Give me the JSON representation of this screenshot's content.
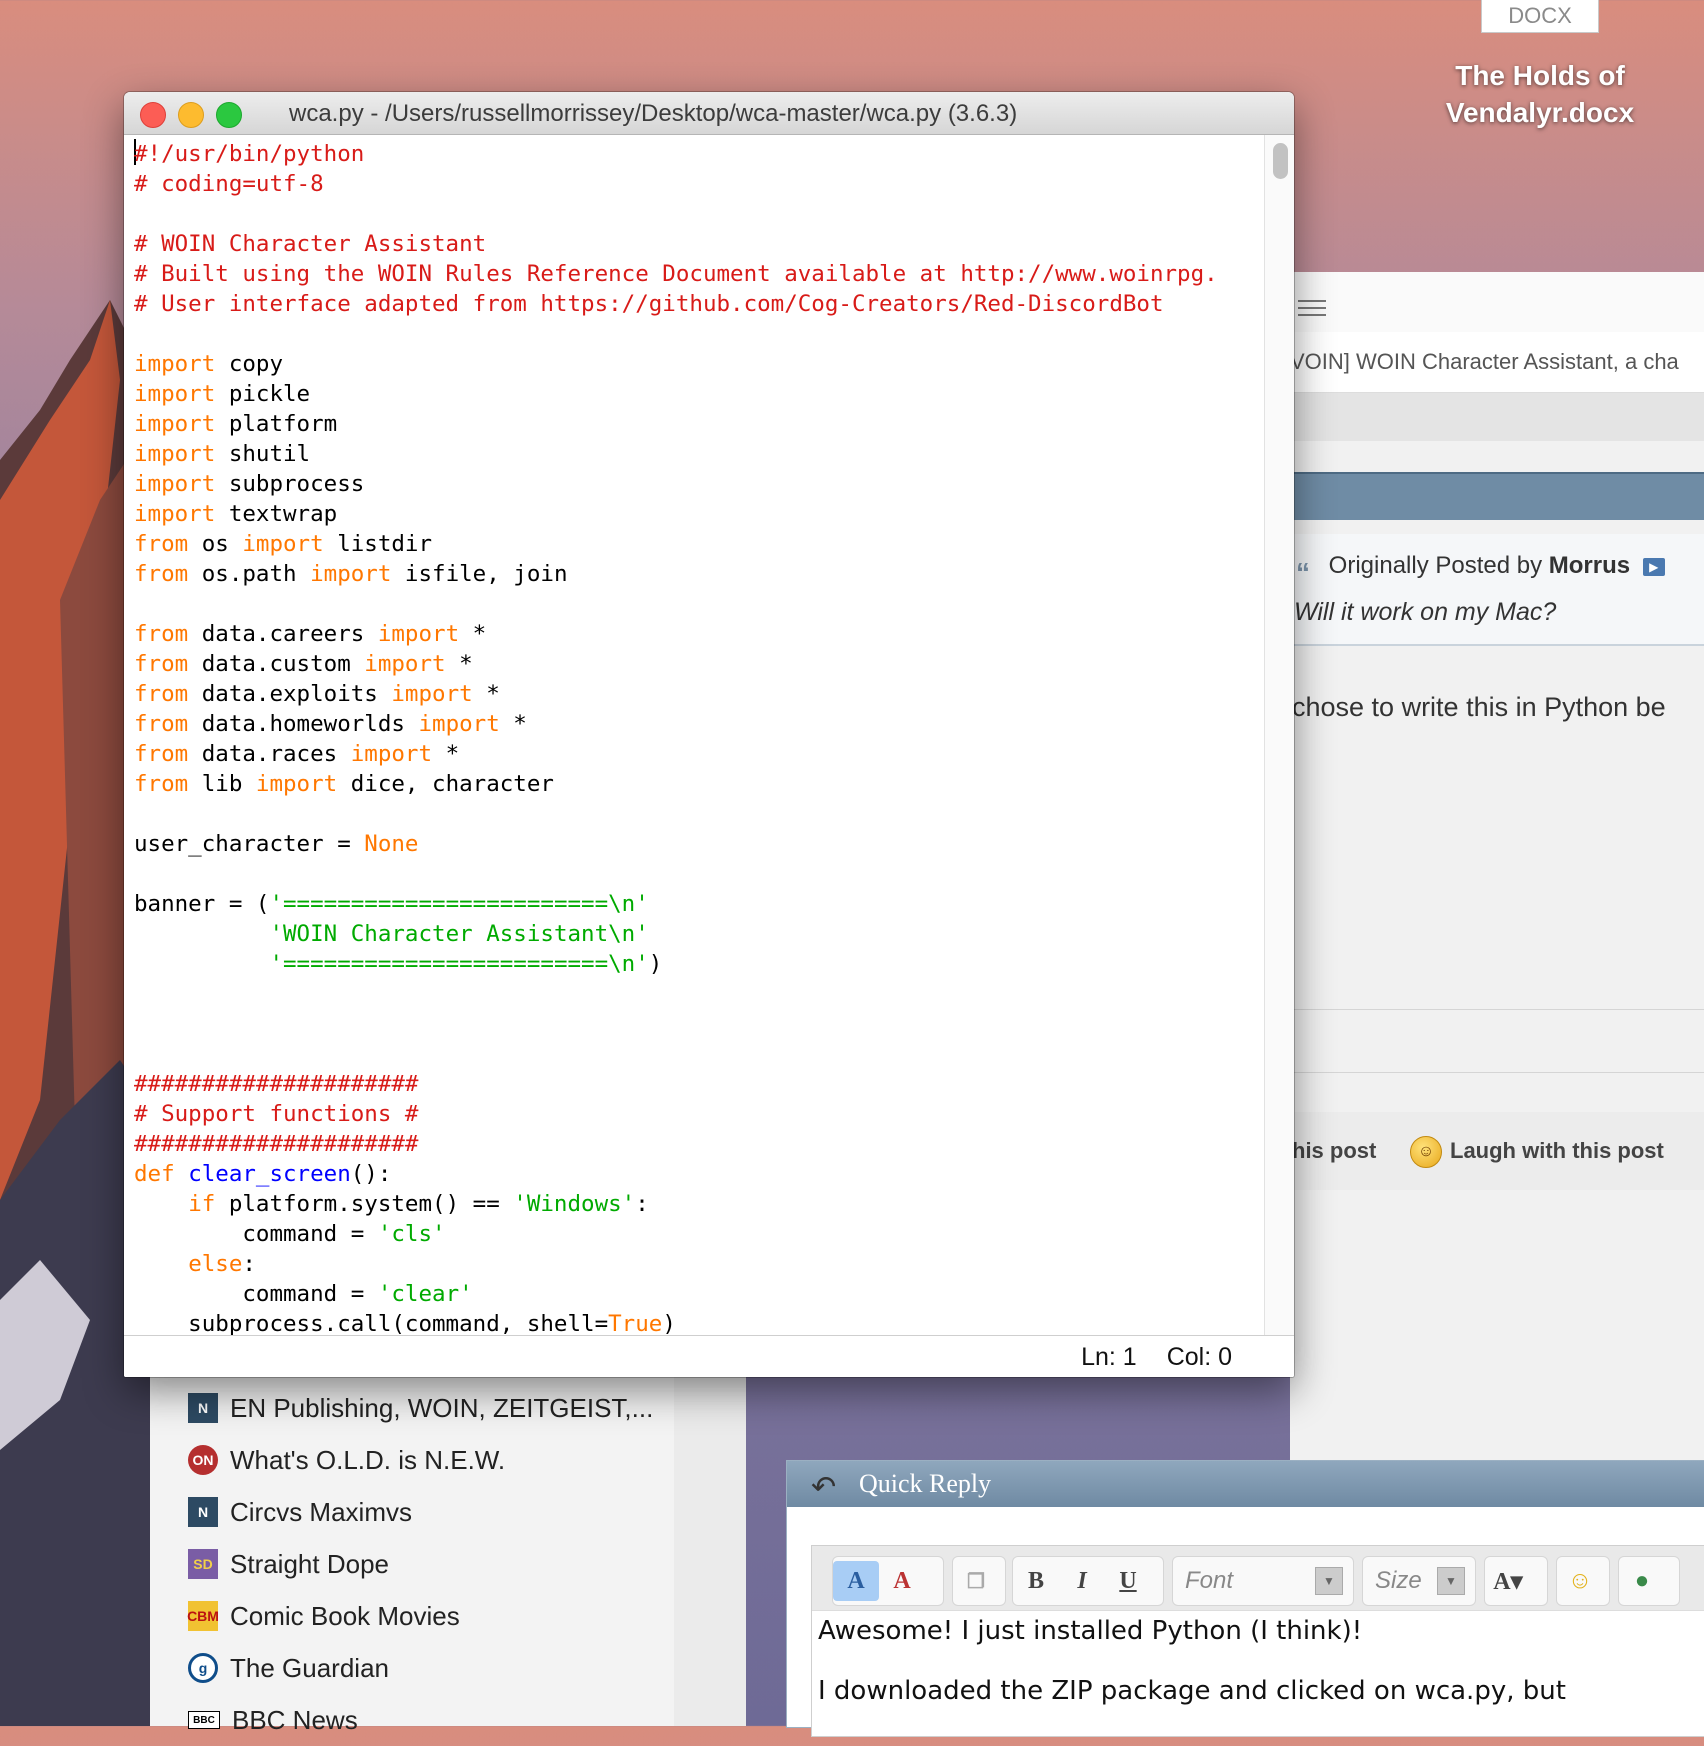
{
  "desktop": {
    "file_icon_label": "DOCX",
    "file_name_line1": "The Holds of",
    "file_name_line2": "Vendalyr.docx"
  },
  "editor": {
    "title": "wca.py - /Users/russellmorrissey/Desktop/wca-master/wca.py (3.6.3)",
    "status_line": "Ln: 1",
    "status_col": "Col: 0"
  },
  "browser": {
    "tab_text": "VOIN] WOIN Character Assistant, a cha",
    "quote": {
      "prefix": "Originally Posted by",
      "author": "Morrus",
      "body": "Will it work on my Mac?"
    },
    "post_text": "chose to write this in Python be",
    "actions": {
      "first": "his post",
      "laugh": "Laugh with this post"
    },
    "sidebar": [
      {
        "label": "EN Publishing, WOIN, ZEITGEIST,...",
        "icon": "en-publishing-icon",
        "glyph": "N"
      },
      {
        "label": "What's O.L.D. is N.E.W.",
        "icon": "old-new-icon",
        "glyph": "ON"
      },
      {
        "label": "Circvs Maximvs",
        "icon": "circvs-icon",
        "glyph": "N"
      },
      {
        "label": "Straight Dope",
        "icon": "straight-dope-icon",
        "glyph": "SD"
      },
      {
        "label": "Comic Book Movies",
        "icon": "cbm-icon",
        "glyph": "CBM"
      },
      {
        "label": "The Guardian",
        "icon": "guardian-icon",
        "glyph": "g"
      },
      {
        "label": "BBC News",
        "icon": "bbc-icon",
        "glyph": "BBC"
      }
    ],
    "quick_reply": {
      "title": "Quick Reply",
      "font_placeholder": "Font",
      "size_placeholder": "Size",
      "bold": "B",
      "italic": "I",
      "underline": "U",
      "text_line1": "Awesome! I just installed Python (I think)!",
      "text_line2": "I downloaded the ZIP package and clicked on wca.py, but"
    }
  },
  "colors": {
    "comment": "#d81b18",
    "keyword": "#ff7700",
    "string": "#00aa00",
    "definition": "#0000ff"
  }
}
